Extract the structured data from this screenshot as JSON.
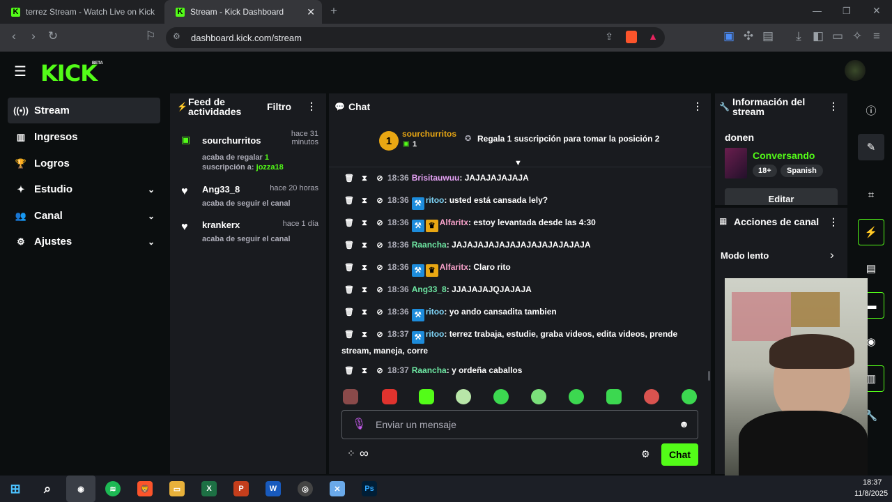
{
  "browser": {
    "tabs": [
      {
        "title": "terrez Stream - Watch Live on Kick"
      },
      {
        "title": "Stream - Kick Dashboard"
      }
    ],
    "url": "dashboard.kick.com/stream"
  },
  "logo": {
    "text": "KICK",
    "beta": "BETA"
  },
  "sidebar": {
    "items": [
      {
        "label": "Stream"
      },
      {
        "label": "Ingresos"
      },
      {
        "label": "Logros"
      },
      {
        "label": "Estudio"
      },
      {
        "label": "Canal"
      },
      {
        "label": "Ajustes"
      }
    ]
  },
  "feed": {
    "title": "Feed de actividades",
    "filter_label": "Filtro",
    "items": [
      {
        "name": "sourchurritos",
        "time": "hace 31 minutos",
        "text": "acaba de regalar ",
        "count": "1",
        "text2": "suscripción a: ",
        "target": "jozza18"
      },
      {
        "name": "Ang33_8",
        "time": "hace 20 horas",
        "text": "acaba de seguir el canal"
      },
      {
        "name": "krankerx",
        "time": "hace 1 día",
        "text": "acaba de seguir el canal"
      }
    ]
  },
  "chat": {
    "title": "Chat",
    "top_gifter": {
      "rank": "1",
      "name": "sourchurritos",
      "count": "1"
    },
    "gift_cta": "Regala 1 suscripción para tomar la posición 2",
    "messages": [
      {
        "time": "18:36",
        "user": "Brisitauwuu",
        "text": ": JAJAJAJAJAJA",
        "color": "#e6a2f5",
        "badges": []
      },
      {
        "time": "18:36",
        "user": "ritoo",
        "text": ": usted está cansada lely?",
        "color": "#7fd6f9",
        "badges": [
          "mod"
        ]
      },
      {
        "time": "18:36",
        "user": "Alfaritx",
        "text": ": estoy levantada desde las 4:30",
        "color": "#f5a0c8",
        "badges": [
          "mod",
          "vip"
        ]
      },
      {
        "time": "18:36",
        "user": "Raancha",
        "text": ": JAJAJAJAJAJAJAJAJAJAJAJAJA",
        "color": "#6ee7a3",
        "badges": []
      },
      {
        "time": "18:36",
        "user": "Alfaritx",
        "text": ": Claro rito",
        "color": "#f5a0c8",
        "badges": [
          "mod",
          "vip"
        ]
      },
      {
        "time": "18:36",
        "user": "Ang33_8",
        "text": ": JJAJAJAJQJAJAJA",
        "color": "#6ee7a3",
        "badges": []
      },
      {
        "time": "18:36",
        "user": "ritoo",
        "text": ": yo ando cansadita tambien",
        "color": "#7fd6f9",
        "badges": [
          "mod"
        ]
      },
      {
        "time": "18:37",
        "user": "ritoo",
        "text": ": terrez trabaja, estudie, graba videos, edita videos, prende stream, maneja, corre",
        "color": "#7fd6f9",
        "badges": [
          "mod"
        ]
      },
      {
        "time": "18:37",
        "user": "Raancha",
        "text": ": y ordeña caballos",
        "color": "#6ee7a3",
        "badges": []
      }
    ],
    "placeholder": "Enviar un mensaje",
    "send_label": "Chat",
    "infinity": "∞"
  },
  "stream_info": {
    "title": "Información del stream",
    "stream_title": "donen",
    "category": "Conversando",
    "tags": [
      "18+",
      "Spanish"
    ],
    "edit_label": "Editar"
  },
  "channel_actions": {
    "title": "Acciones de canal",
    "slow_mode": "Modo lento"
  },
  "taskbar": {
    "time": "18:37",
    "date": "11/8/2025"
  },
  "colors": {
    "accent": "#53fc18",
    "panel": "#191b1f",
    "bg": "#0b0e0f"
  }
}
